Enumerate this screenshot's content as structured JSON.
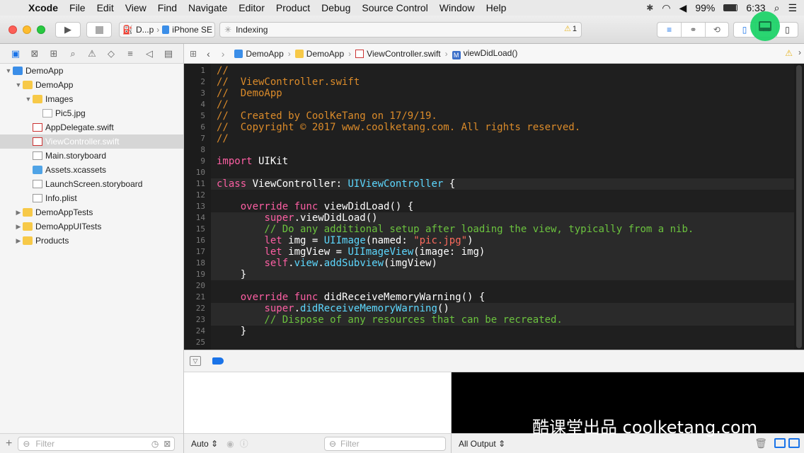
{
  "menubar": {
    "app": "Xcode",
    "items": [
      "File",
      "Edit",
      "View",
      "Find",
      "Navigate",
      "Editor",
      "Product",
      "Debug",
      "Source Control",
      "Window",
      "Help"
    ],
    "battery": "99%",
    "time": "6:33"
  },
  "toolbar": {
    "scheme_target": "D...p",
    "scheme_device": "iPhone SE",
    "activity_status": "Indexing",
    "warning_count": "1",
    "highlight_badge": "18"
  },
  "navigator": {
    "items": [
      {
        "label": "DemoApp",
        "icon": "project-icon",
        "indent": 0,
        "disclosure": "open"
      },
      {
        "label": "DemoApp",
        "icon": "folder-icon",
        "indent": 1,
        "disclosure": "open"
      },
      {
        "label": "Images",
        "icon": "folder-icon",
        "indent": 2,
        "disclosure": "open"
      },
      {
        "label": "Pic5.jpg",
        "icon": "image-file-icon",
        "indent": 3,
        "disclosure": ""
      },
      {
        "label": "AppDelegate.swift",
        "icon": "swift-file-icon",
        "indent": 2,
        "disclosure": ""
      },
      {
        "label": "ViewController.swift",
        "icon": "swift-file-icon",
        "indent": 2,
        "disclosure": "",
        "selected": true
      },
      {
        "label": "Main.storyboard",
        "icon": "storyboard-file-icon",
        "indent": 2,
        "disclosure": ""
      },
      {
        "label": "Assets.xcassets",
        "icon": "asset-catalog-icon",
        "indent": 2,
        "disclosure": ""
      },
      {
        "label": "LaunchScreen.storyboard",
        "icon": "storyboard-file-icon",
        "indent": 2,
        "disclosure": ""
      },
      {
        "label": "Info.plist",
        "icon": "plist-file-icon",
        "indent": 2,
        "disclosure": ""
      },
      {
        "label": "DemoAppTests",
        "icon": "folder-icon",
        "indent": 1,
        "disclosure": "closed"
      },
      {
        "label": "DemoAppUITests",
        "icon": "folder-icon",
        "indent": 1,
        "disclosure": "closed"
      },
      {
        "label": "Products",
        "icon": "folder-icon",
        "indent": 1,
        "disclosure": "closed"
      }
    ],
    "filter_placeholder": "Filter"
  },
  "jumpbar": {
    "crumbs": [
      "DemoApp",
      "DemoApp",
      "ViewController.swift",
      "viewDidLoad()"
    ]
  },
  "editor": {
    "lines": [
      "//",
      "//  ViewController.swift",
      "//  DemoApp",
      "//",
      "//  Created by CoolKeTang on 17/9/19.",
      "//  Copyright © 2017 www.coolketang.com. All rights reserved.",
      "//",
      "",
      "import UIKit",
      "",
      "class ViewController: UIViewController {",
      "",
      "    override func viewDidLoad() {",
      "        super.viewDidLoad()",
      "        // Do any additional setup after loading the view, typically from a nib.",
      "        let img = UIImage(named: \"pic.jpg\")",
      "        let imgView = UIImageView(image: img)",
      "        self.view.addSubview(imgView)",
      "    }",
      "",
      "    override func didReceiveMemoryWarning() {",
      "        super.didReceiveMemoryWarning()",
      "        // Dispose of any resources that can be recreated.",
      "    }",
      ""
    ]
  },
  "debug": {
    "auto_label": "Auto",
    "filter_placeholder": "Filter",
    "output_label": "All Output"
  },
  "watermark": "酷课堂出品 coolketang.com",
  "colors": {
    "comment": "#db8b2a",
    "keyword": "#fc5fa3",
    "type": "#5dd8ff",
    "string": "#fc6a5d",
    "inline_comment": "#6bc23e",
    "highlight": "#1fd36a"
  }
}
